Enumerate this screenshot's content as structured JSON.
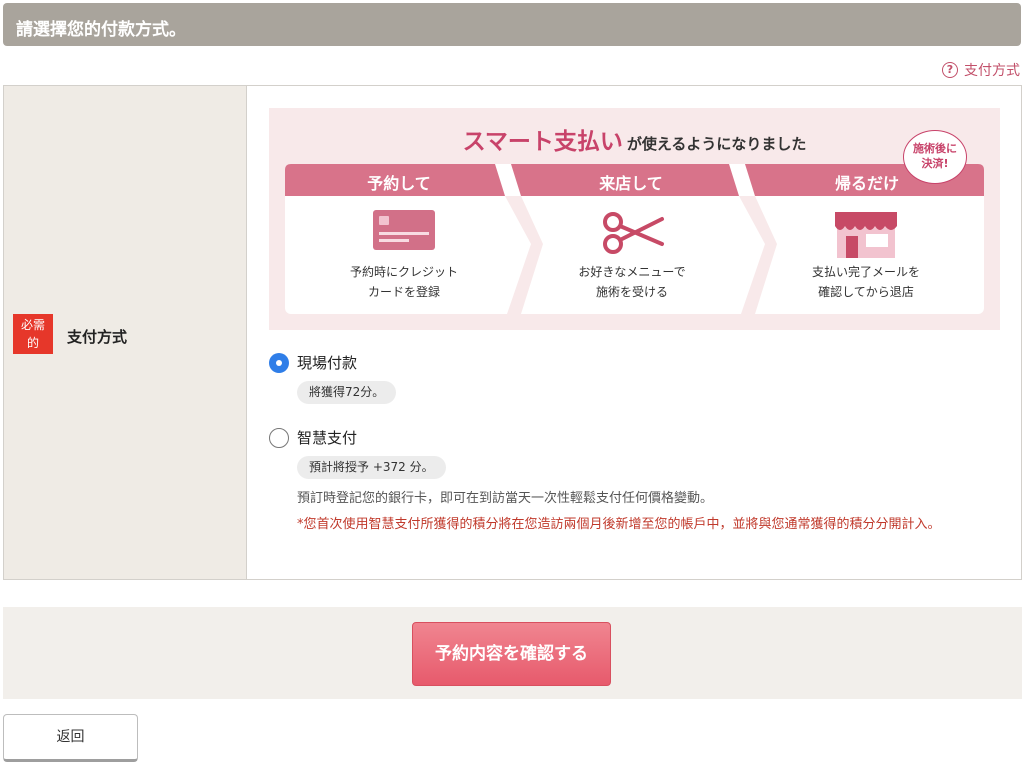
{
  "header": {
    "title": "請選擇您的付款方式。"
  },
  "help": {
    "label": "支付方式",
    "icon": "question-circle-icon"
  },
  "field": {
    "required_badge_line1": "必需",
    "required_badge_line2": "的",
    "label": "支付方式"
  },
  "banner": {
    "title_big": "スマート支払い",
    "title_small": "が使えるようになりました",
    "callout_line1": "施術後に",
    "callout_line2": "決済!",
    "steps": [
      {
        "head": "予約して",
        "line1": "予約時にクレジット",
        "line2": "カードを登録",
        "icon": "credit-card-icon"
      },
      {
        "head": "来店して",
        "line1": "お好きなメニューで",
        "line2": "施術を受ける",
        "icon": "scissors-icon"
      },
      {
        "head": "帰るだけ",
        "line1": "支払い完了メールを",
        "line2": "確認してから退店",
        "icon": "storefront-icon"
      }
    ]
  },
  "options": [
    {
      "label": "現場付款",
      "checked": true,
      "points": "將獲得72分。"
    },
    {
      "label": "智慧支付",
      "checked": false,
      "points": "預計將授予 +372 分。",
      "description": "預訂時登記您的銀行卡，即可在到訪當天一次性輕鬆支付任何價格變動。",
      "note": "*您首次使用智慧支付所獲得的積分將在您造訪兩個月後新增至您的帳戶中，並將與您通常獲得的積分分開計入。"
    }
  ],
  "buttons": {
    "confirm": "予約内容を確認する",
    "back": "返回"
  },
  "colors": {
    "accent": "#c8436a",
    "step_header": "#d8738a",
    "radio_checked": "#2f7ee8",
    "required": "#e6372a"
  }
}
